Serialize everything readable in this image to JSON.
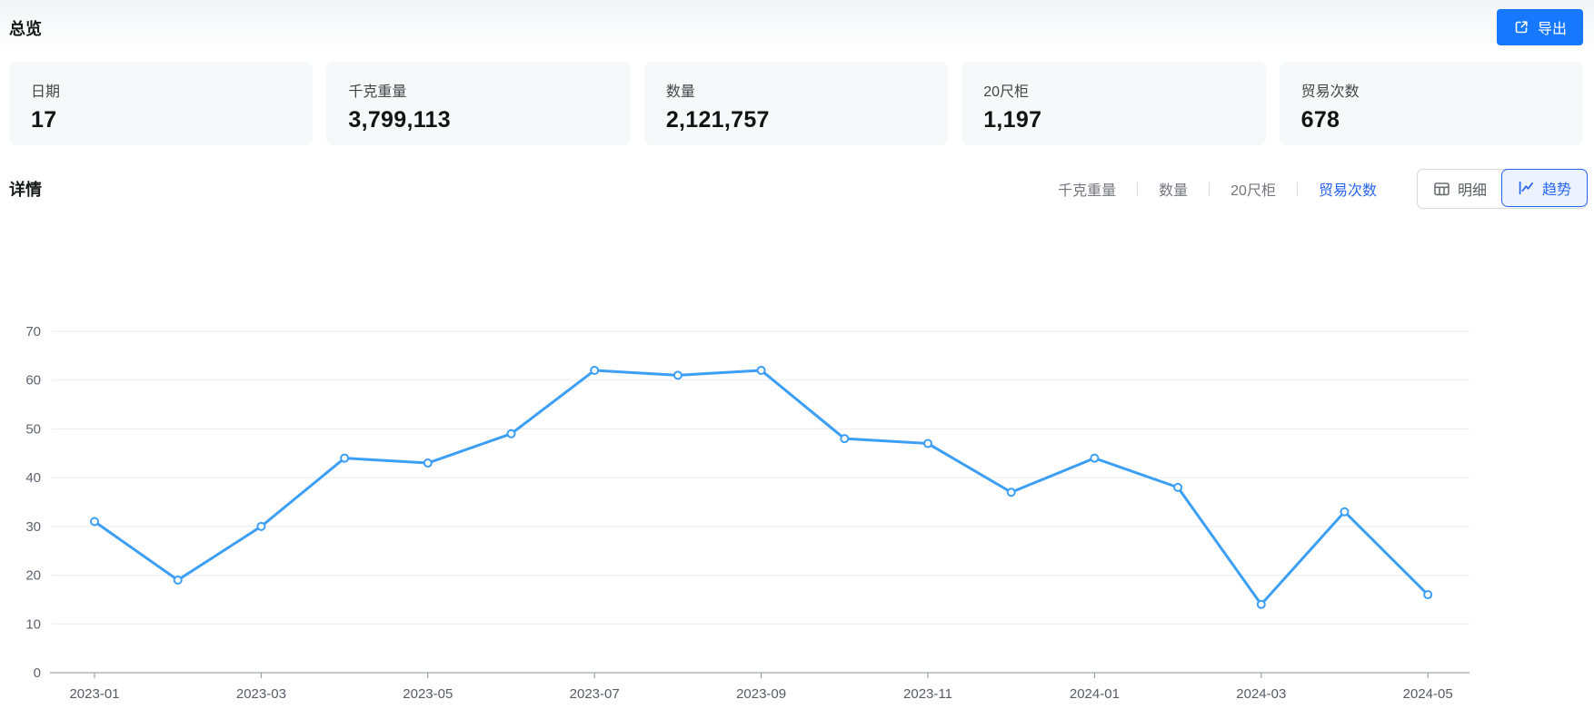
{
  "overview": {
    "title": "总览",
    "export_label": "导出",
    "cards": [
      {
        "label": "日期",
        "value": "17"
      },
      {
        "label": "千克重量",
        "value": "3,799,113"
      },
      {
        "label": "数量",
        "value": "2,121,757"
      },
      {
        "label": "20尺柜",
        "value": "1,197"
      },
      {
        "label": "贸易次数",
        "value": "678"
      }
    ]
  },
  "details": {
    "title": "详情",
    "metric_tabs": [
      {
        "label": "千克重量",
        "active": false
      },
      {
        "label": "数量",
        "active": false
      },
      {
        "label": "20尺柜",
        "active": false
      },
      {
        "label": "贸易次数",
        "active": true
      }
    ],
    "view_toggle": [
      {
        "label": "明细",
        "icon": "table-icon",
        "active": false
      },
      {
        "label": "趋势",
        "icon": "trend-icon",
        "active": true
      }
    ]
  },
  "chart_data": {
    "type": "line",
    "title": "",
    "x": [
      "2023-01",
      "2023-02",
      "2023-03",
      "2023-04",
      "2023-05",
      "2023-06",
      "2023-07",
      "2023-08",
      "2023-09",
      "2023-10",
      "2023-11",
      "2023-12",
      "2024-01",
      "2024-02",
      "2024-03",
      "2024-04",
      "2024-05"
    ],
    "values": [
      31,
      19,
      30,
      44,
      43,
      49,
      62,
      61,
      62,
      48,
      47,
      37,
      44,
      38,
      14,
      33,
      16
    ],
    "x_tick_labels": [
      "2023-01",
      "2023-03",
      "2023-05",
      "2023-07",
      "2023-09",
      "2023-11",
      "2024-01",
      "2024-03",
      "2024-05"
    ],
    "xlabel": "",
    "ylabel": "",
    "ylim": [
      0,
      70
    ],
    "y_ticks": [
      0,
      10,
      20,
      30,
      40,
      50,
      60,
      70
    ],
    "grid": true,
    "legend": "none",
    "series_name": "贸易次数",
    "line_color": "#3c9ff5",
    "point_style": "hollow-circle"
  },
  "colors": {
    "primary_button": "#1677ff",
    "accent_text": "#2766f4",
    "active_toggle_bg": "#edf3fe",
    "card_bg": "#f7f8fa",
    "grid_line": "#e8ebf1",
    "axis_line": "#8d9098"
  }
}
